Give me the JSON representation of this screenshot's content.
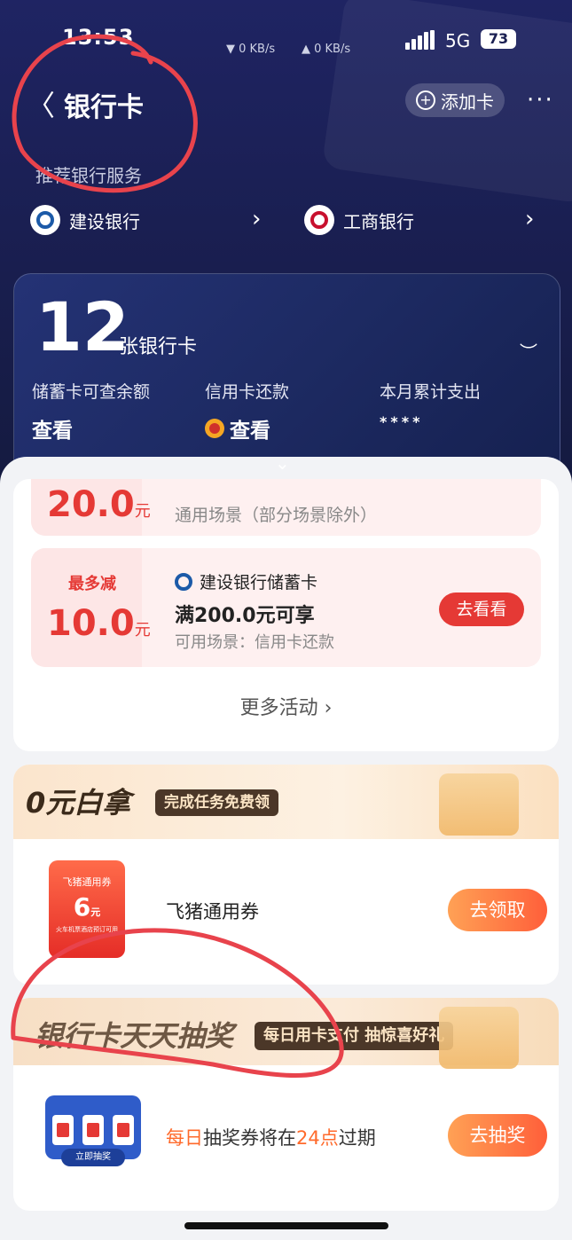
{
  "status_bar": {
    "time": "13:53",
    "net_down": "▼ 0 KB/s",
    "net_up": "▲ 0 KB/s",
    "network": "5G",
    "battery": "73"
  },
  "nav": {
    "back": "〈",
    "title": "银行卡",
    "add_card": "添加卡",
    "more": "···"
  },
  "recommend": {
    "label": "推荐银行服务",
    "banks": [
      {
        "name": "建设银行",
        "arrow": "›"
      },
      {
        "name": "工商银行",
        "arrow": "›"
      }
    ]
  },
  "summary": {
    "count": "12",
    "count_label": "张银行卡",
    "eye": "︶",
    "columns": [
      {
        "label": "储蓄卡可查余额",
        "value": "查看"
      },
      {
        "label": "信用卡还款",
        "value": "查看"
      },
      {
        "label": "本月累计支出",
        "value": "****"
      }
    ],
    "expand": "⌄"
  },
  "coupons": [
    {
      "amount": "20.0",
      "unit": "元",
      "scene": "通用场景（部分场景除外）"
    },
    {
      "max_label": "最多减",
      "amount": "10.0",
      "unit": "元",
      "bank": "建设银行储蓄卡",
      "condition": "满200.0元可享",
      "scene": "可用场景：信用卡还款",
      "button": "去看看"
    }
  ],
  "more_activities": "更多活动 ›",
  "free_section": {
    "title": "0元白拿",
    "tag": "完成任务免费领",
    "voucher_title": "飞猪通用券",
    "voucher_value": "6",
    "voucher_unit": "元",
    "voucher_sub": "火车机票酒店预订可用",
    "item_label": "飞猪通用券",
    "button": "去领取"
  },
  "lottery_section": {
    "title": "银行卡天天抽奖",
    "tag": "每日用卡支付 抽惊喜好礼",
    "machine_button": "立即抽奖",
    "text_pre": "每日",
    "text_mid": "抽奖券将在",
    "text_hl": "24点",
    "text_post": "过期",
    "button": "去抽奖"
  },
  "colors": {
    "accent": "#e53935",
    "orange": "#ff6a2b",
    "header_bg": "#1a1f52",
    "annotation": "#e8434c"
  }
}
